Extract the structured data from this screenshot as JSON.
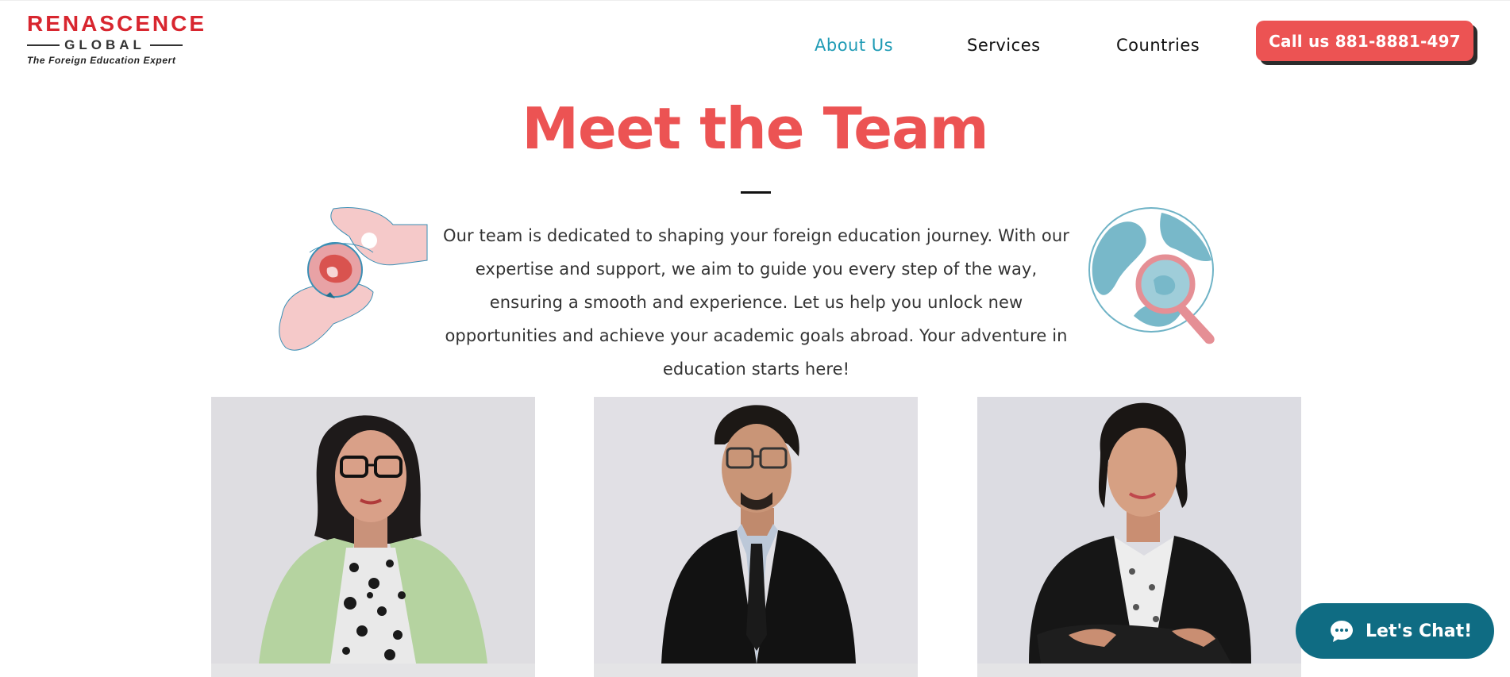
{
  "logo": {
    "top": "RENASCENCE",
    "mid": "GLOBAL",
    "tagline": "The Foreign Education Expert"
  },
  "nav": {
    "about": "About Us",
    "services": "Services",
    "countries": "Countries"
  },
  "call_button": "Call us 881-8881-497",
  "section": {
    "title": "Meet the Team",
    "intro": "Our team is dedicated to shaping your foreign education journey. With our expertise and support, we aim to guide you every step of the way, ensuring a smooth and experience. Let us help you unlock new opportunities and achieve your academic goals abroad. Your adventure in education starts here!"
  },
  "chat_button": "Let's Chat!",
  "colors": {
    "accent_red": "#ec5353",
    "nav_active": "#1f9bb5",
    "chat_teal": "#0f6c83"
  }
}
